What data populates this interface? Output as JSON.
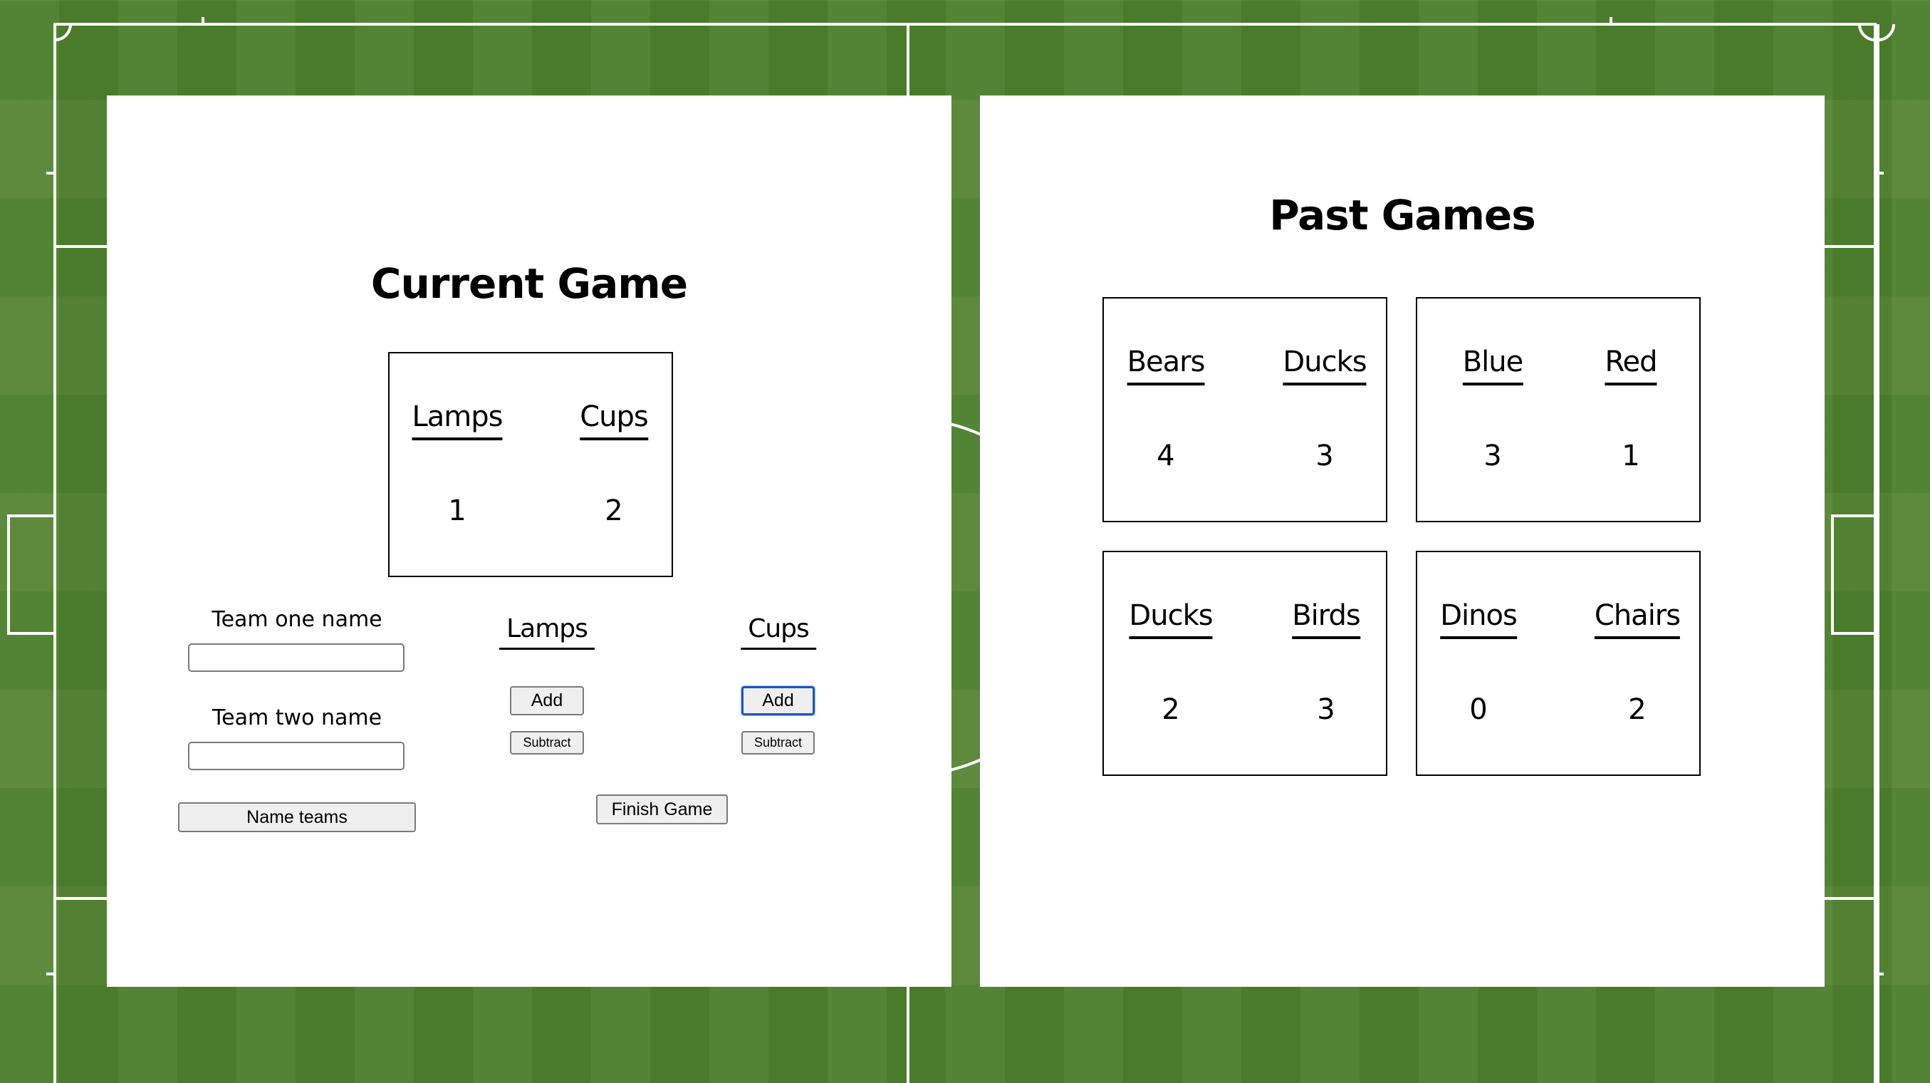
{
  "current_game": {
    "title": "Current Game",
    "team_one": "Lamps",
    "team_two": "Cups",
    "score_one": "1",
    "score_two": "2"
  },
  "naming": {
    "team_one_label": "Team one name",
    "team_one_value": "",
    "team_two_label": "Team two name",
    "team_two_value": "",
    "name_teams_button": "Name teams"
  },
  "controls": {
    "team_one_heading": "Lamps",
    "team_two_heading": "Cups",
    "add_label": "Add",
    "subtract_label": "Subtract",
    "finish_label": "Finish Game"
  },
  "past_games": {
    "title": "Past Games",
    "games": [
      {
        "team_one": "Bears",
        "team_two": "Ducks",
        "score_one": "4",
        "score_two": "3"
      },
      {
        "team_one": "Blue",
        "team_two": "Red",
        "score_one": "3",
        "score_two": "1"
      },
      {
        "team_one": "Ducks",
        "team_two": "Birds",
        "score_one": "2",
        "score_two": "3"
      },
      {
        "team_one": "Dinos",
        "team_two": "Chairs",
        "score_one": "0",
        "score_two": "2"
      }
    ]
  },
  "colors": {
    "field_green": "#4b7f2c",
    "field_lines": "#ffffff",
    "panel_background": "#ffffff",
    "focus_ring": "#1a56c8"
  }
}
